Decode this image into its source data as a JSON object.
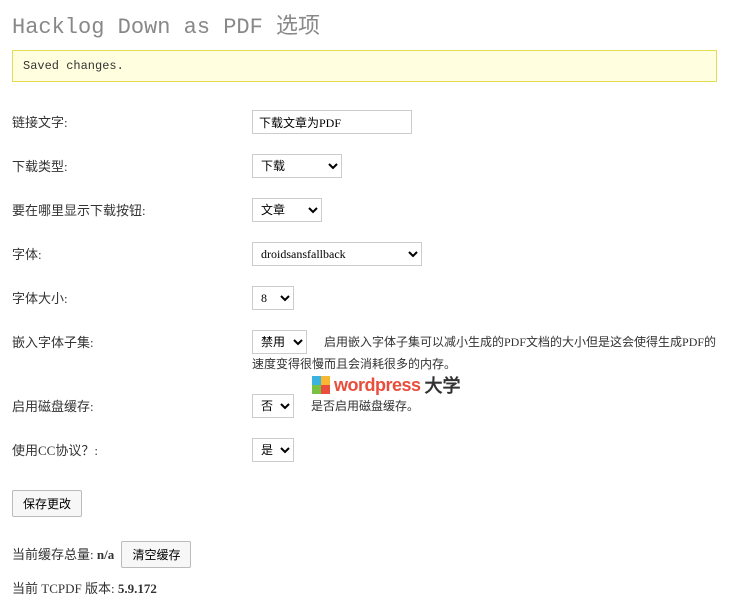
{
  "page": {
    "title": "Hacklog Down as PDF 选项"
  },
  "notice": {
    "message": "Saved changes."
  },
  "fields": {
    "link_text": {
      "label": "链接文字:",
      "value": "下载文章为PDF"
    },
    "download_type": {
      "label": "下载类型:",
      "selected": "下载"
    },
    "display_where": {
      "label": "要在哪里显示下载按钮:",
      "selected": "文章"
    },
    "font": {
      "label": "字体:",
      "selected": "droidsansfallback"
    },
    "font_size": {
      "label": "字体大小:",
      "selected": "8"
    },
    "embed_subset": {
      "label": "嵌入字体子集:",
      "selected": "禁用",
      "desc": "启用嵌入字体子集可以减小生成的PDF文档的大小但是这会使得生成PDF的速度变得很慢而且会消耗很多的内存。"
    },
    "disk_cache": {
      "label": "启用磁盘缓存:",
      "selected": "否",
      "desc": "是否启用磁盘缓存。"
    },
    "cc_license": {
      "label": "使用CC协议？:",
      "selected": "是"
    }
  },
  "buttons": {
    "save": "保存更改",
    "clear_cache": "清空缓存"
  },
  "info": {
    "cache_total_label": "当前缓存总量: ",
    "cache_total_value": "n/a",
    "tcpdf_label": "当前 TCPDF 版本: ",
    "tcpdf_version": "5.9.172"
  },
  "watermark": {
    "text1": "wordpress",
    "text2": "大学"
  }
}
